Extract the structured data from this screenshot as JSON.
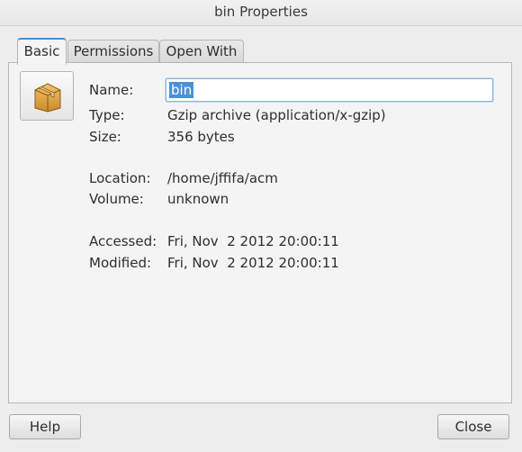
{
  "window": {
    "title": "bin Properties"
  },
  "tabs": [
    {
      "label": "Basic",
      "active": true
    },
    {
      "label": "Permissions",
      "active": false
    },
    {
      "label": "Open With",
      "active": false
    }
  ],
  "icon": {
    "name": "package-archive-icon"
  },
  "fields": {
    "name": {
      "label": "Name:",
      "value": "bin"
    },
    "type": {
      "label": "Type:",
      "value": "Gzip archive (application/x-gzip)"
    },
    "size": {
      "label": "Size:",
      "value": "356 bytes"
    },
    "location": {
      "label": "Location:",
      "value": "/home/jffifa/acm"
    },
    "volume": {
      "label": "Volume:",
      "value": "unknown"
    },
    "accessed": {
      "label": "Accessed:",
      "value": "Fri, Nov  2 2012 20:00:11"
    },
    "modified": {
      "label": "Modified:",
      "value": "Fri, Nov  2 2012 20:00:11"
    }
  },
  "buttons": {
    "help": "Help",
    "close": "Close"
  },
  "colors": {
    "accent": "#4a90d9",
    "background": "#ededed"
  }
}
